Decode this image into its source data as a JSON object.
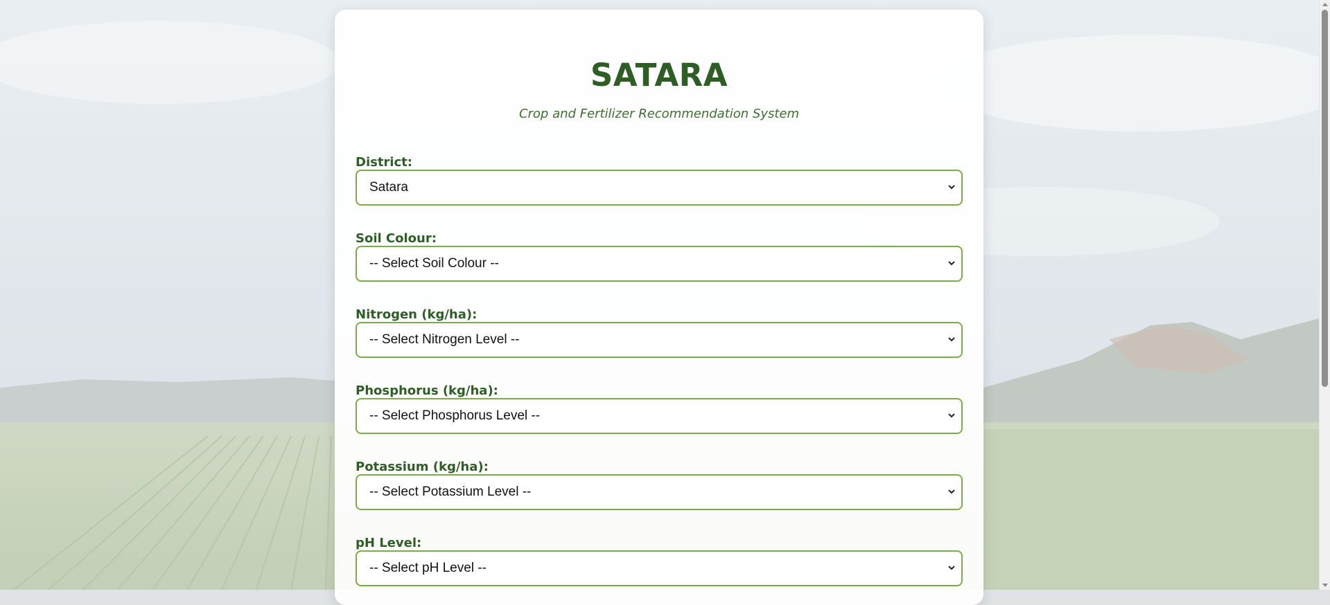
{
  "header": {
    "title": "SATARA",
    "subtitle": "Crop and Fertilizer Recommendation System"
  },
  "form": {
    "fields": [
      {
        "label": "District:",
        "value": "Satara"
      },
      {
        "label": "Soil Colour:",
        "value": "-- Select Soil Colour --"
      },
      {
        "label": "Nitrogen (kg/ha):",
        "value": "-- Select Nitrogen Level --"
      },
      {
        "label": "Phosphorus (kg/ha):",
        "value": "-- Select Phosphorus Level --"
      },
      {
        "label": "Potassium (kg/ha):",
        "value": "-- Select Potassium Level --"
      },
      {
        "label": "pH Level:",
        "value": "-- Select pH Level --"
      }
    ]
  },
  "colors": {
    "primary_green": "#2e5e25",
    "field_border": "#7aad45"
  },
  "icons": {
    "select_arrow": "chevron-down-icon"
  }
}
